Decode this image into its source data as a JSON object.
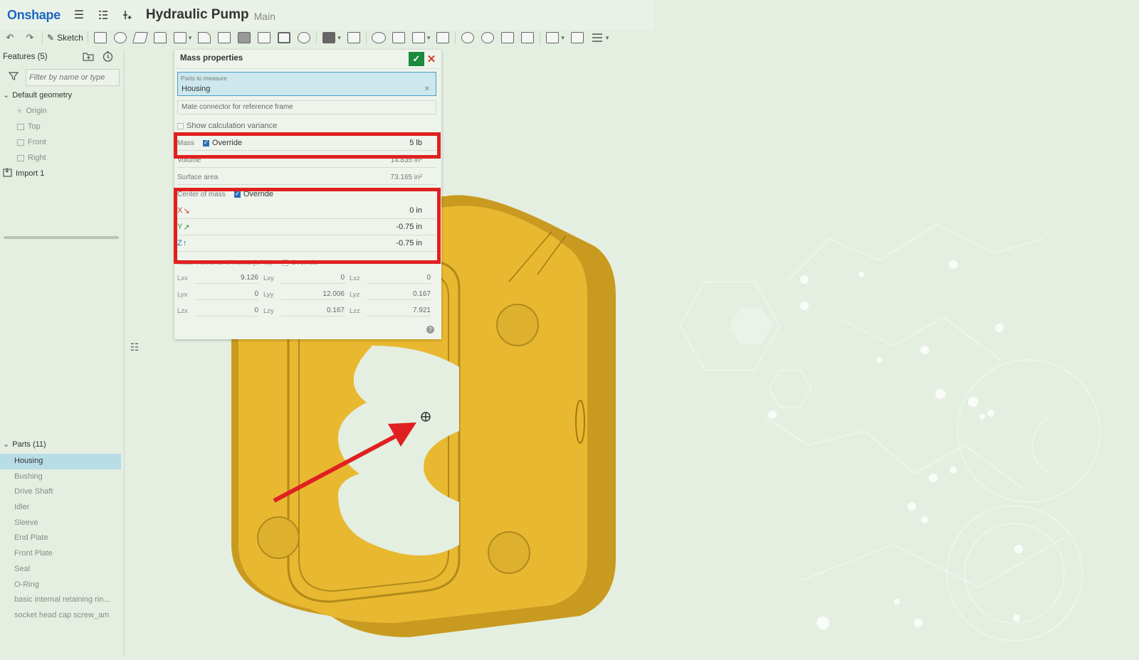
{
  "header": {
    "logo": "Onshape",
    "doc_title": "Hydraulic Pump",
    "doc_branch": "Main"
  },
  "toolbar": {
    "sketch_label": "Sketch"
  },
  "features_panel": {
    "title": "Features (5)",
    "filter_placeholder": "Filter by name or type",
    "default_geometry_label": "Default geometry",
    "items": [
      "Origin",
      "Top",
      "Front",
      "Right"
    ],
    "import_label": "Import 1"
  },
  "parts_panel": {
    "title": "Parts (11)",
    "items": [
      "Housing",
      "Bushing",
      "Drive Shaft",
      "Idler",
      "Sleeve",
      "End Plate",
      "Front Plate",
      "Seal",
      "O-Ring",
      "basic internal retaining rin...",
      "socket head cap screw_am"
    ],
    "selected_index": 0
  },
  "mass_dialog": {
    "title": "Mass properties",
    "parts_label": "Parts to measure",
    "parts_value": "Housing",
    "mate_connector_placeholder": "Mate connector for reference frame",
    "calc_variance_label": "Show calculation variance",
    "mass_label": "Mass",
    "override_label": "Override",
    "mass_value": "5 lb",
    "volume_label": "Volume",
    "volume_value": "14.835 in³",
    "surface_area_label": "Surface area",
    "surface_area_value": "73.165 in²",
    "com_label": "Center of mass",
    "com_x": "0 in",
    "com_y": "-0.75 in",
    "com_z": "-0.75 in",
    "axis_x": "X",
    "axis_y": "Y",
    "axis_z": "Z",
    "moi_label": "Mass moments of inertia (in² lb)",
    "moi": [
      [
        {
          "l": "Lxx",
          "v": "9.126"
        },
        {
          "l": "Lxy",
          "v": "0"
        },
        {
          "l": "Lxz",
          "v": "0"
        }
      ],
      [
        {
          "l": "Lyx",
          "v": "0"
        },
        {
          "l": "Lyy",
          "v": "12.006"
        },
        {
          "l": "Lyz",
          "v": "0.167"
        }
      ],
      [
        {
          "l": "Lzx",
          "v": "0"
        },
        {
          "l": "Lzy",
          "v": "0.167"
        },
        {
          "l": "Lzz",
          "v": "7.921"
        }
      ]
    ]
  },
  "colors": {
    "accent": "#1a66c2",
    "highlight_red": "#e02020",
    "part_yellow": "#e8b830",
    "selection": "#b9dde6",
    "confirm_green": "#1a8a3c"
  }
}
